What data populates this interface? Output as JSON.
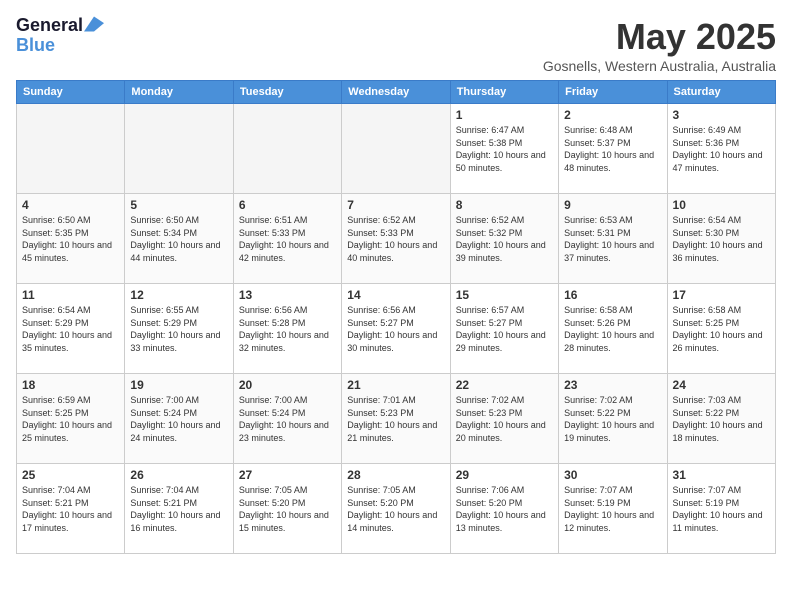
{
  "header": {
    "logo_line1": "General",
    "logo_line2": "Blue",
    "title": "May 2025",
    "location": "Gosnells, Western Australia, Australia"
  },
  "weekdays": [
    "Sunday",
    "Monday",
    "Tuesday",
    "Wednesday",
    "Thursday",
    "Friday",
    "Saturday"
  ],
  "weeks": [
    [
      {
        "day": "",
        "empty": true
      },
      {
        "day": "",
        "empty": true
      },
      {
        "day": "",
        "empty": true
      },
      {
        "day": "",
        "empty": true
      },
      {
        "day": "1",
        "sunrise": "6:47 AM",
        "sunset": "5:38 PM",
        "daylight": "10 hours and 50 minutes."
      },
      {
        "day": "2",
        "sunrise": "6:48 AM",
        "sunset": "5:37 PM",
        "daylight": "10 hours and 48 minutes."
      },
      {
        "day": "3",
        "sunrise": "6:49 AM",
        "sunset": "5:36 PM",
        "daylight": "10 hours and 47 minutes."
      }
    ],
    [
      {
        "day": "4",
        "sunrise": "6:50 AM",
        "sunset": "5:35 PM",
        "daylight": "10 hours and 45 minutes."
      },
      {
        "day": "5",
        "sunrise": "6:50 AM",
        "sunset": "5:34 PM",
        "daylight": "10 hours and 44 minutes."
      },
      {
        "day": "6",
        "sunrise": "6:51 AM",
        "sunset": "5:33 PM",
        "daylight": "10 hours and 42 minutes."
      },
      {
        "day": "7",
        "sunrise": "6:52 AM",
        "sunset": "5:33 PM",
        "daylight": "10 hours and 40 minutes."
      },
      {
        "day": "8",
        "sunrise": "6:52 AM",
        "sunset": "5:32 PM",
        "daylight": "10 hours and 39 minutes."
      },
      {
        "day": "9",
        "sunrise": "6:53 AM",
        "sunset": "5:31 PM",
        "daylight": "10 hours and 37 minutes."
      },
      {
        "day": "10",
        "sunrise": "6:54 AM",
        "sunset": "5:30 PM",
        "daylight": "10 hours and 36 minutes."
      }
    ],
    [
      {
        "day": "11",
        "sunrise": "6:54 AM",
        "sunset": "5:29 PM",
        "daylight": "10 hours and 35 minutes."
      },
      {
        "day": "12",
        "sunrise": "6:55 AM",
        "sunset": "5:29 PM",
        "daylight": "10 hours and 33 minutes."
      },
      {
        "day": "13",
        "sunrise": "6:56 AM",
        "sunset": "5:28 PM",
        "daylight": "10 hours and 32 minutes."
      },
      {
        "day": "14",
        "sunrise": "6:56 AM",
        "sunset": "5:27 PM",
        "daylight": "10 hours and 30 minutes."
      },
      {
        "day": "15",
        "sunrise": "6:57 AM",
        "sunset": "5:27 PM",
        "daylight": "10 hours and 29 minutes."
      },
      {
        "day": "16",
        "sunrise": "6:58 AM",
        "sunset": "5:26 PM",
        "daylight": "10 hours and 28 minutes."
      },
      {
        "day": "17",
        "sunrise": "6:58 AM",
        "sunset": "5:25 PM",
        "daylight": "10 hours and 26 minutes."
      }
    ],
    [
      {
        "day": "18",
        "sunrise": "6:59 AM",
        "sunset": "5:25 PM",
        "daylight": "10 hours and 25 minutes."
      },
      {
        "day": "19",
        "sunrise": "7:00 AM",
        "sunset": "5:24 PM",
        "daylight": "10 hours and 24 minutes."
      },
      {
        "day": "20",
        "sunrise": "7:00 AM",
        "sunset": "5:24 PM",
        "daylight": "10 hours and 23 minutes."
      },
      {
        "day": "21",
        "sunrise": "7:01 AM",
        "sunset": "5:23 PM",
        "daylight": "10 hours and 21 minutes."
      },
      {
        "day": "22",
        "sunrise": "7:02 AM",
        "sunset": "5:23 PM",
        "daylight": "10 hours and 20 minutes."
      },
      {
        "day": "23",
        "sunrise": "7:02 AM",
        "sunset": "5:22 PM",
        "daylight": "10 hours and 19 minutes."
      },
      {
        "day": "24",
        "sunrise": "7:03 AM",
        "sunset": "5:22 PM",
        "daylight": "10 hours and 18 minutes."
      }
    ],
    [
      {
        "day": "25",
        "sunrise": "7:04 AM",
        "sunset": "5:21 PM",
        "daylight": "10 hours and 17 minutes."
      },
      {
        "day": "26",
        "sunrise": "7:04 AM",
        "sunset": "5:21 PM",
        "daylight": "10 hours and 16 minutes."
      },
      {
        "day": "27",
        "sunrise": "7:05 AM",
        "sunset": "5:20 PM",
        "daylight": "10 hours and 15 minutes."
      },
      {
        "day": "28",
        "sunrise": "7:05 AM",
        "sunset": "5:20 PM",
        "daylight": "10 hours and 14 minutes."
      },
      {
        "day": "29",
        "sunrise": "7:06 AM",
        "sunset": "5:20 PM",
        "daylight": "10 hours and 13 minutes."
      },
      {
        "day": "30",
        "sunrise": "7:07 AM",
        "sunset": "5:19 PM",
        "daylight": "10 hours and 12 minutes."
      },
      {
        "day": "31",
        "sunrise": "7:07 AM",
        "sunset": "5:19 PM",
        "daylight": "10 hours and 11 minutes."
      }
    ]
  ]
}
